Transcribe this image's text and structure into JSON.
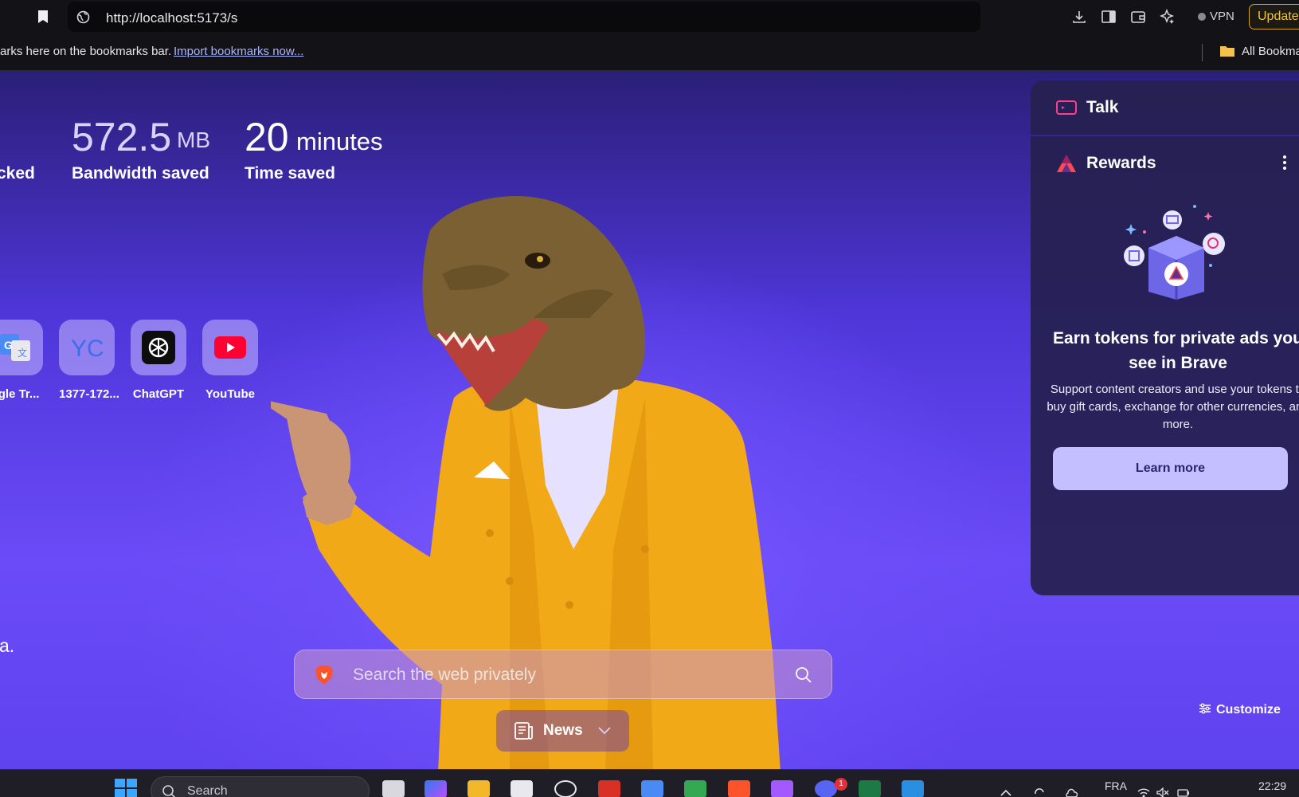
{
  "browser": {
    "url": "http://localhost:5173/s",
    "vpn_label": "VPN",
    "update_label": "Update"
  },
  "bookmarks_bar": {
    "prompt_text": "arks here on the bookmarks bar.",
    "import_link": "Import bookmarks now...",
    "all_bookmarks": "All Bookma"
  },
  "stats": {
    "blocked_label": "cked",
    "bandwidth_value": "572.5",
    "bandwidth_unit": "MB",
    "bandwidth_label": "Bandwidth saved",
    "time_value": "20",
    "time_unit": "minutes",
    "time_label": "Time saved"
  },
  "top_sites": [
    {
      "name": "ogle Tr..."
    },
    {
      "name": "1377-172..."
    },
    {
      "name": "ChatGPT"
    },
    {
      "name": "YouTube"
    }
  ],
  "page_fragment": "a.",
  "search": {
    "placeholder": "Search the web privately"
  },
  "news": {
    "label": "News"
  },
  "customize": {
    "label": "Customize"
  },
  "widgets": {
    "talk_title": "Talk",
    "rewards_title": "Rewards",
    "rewards_headline": "Earn tokens for private ads you see in Brave",
    "rewards_body": "Support content creators and use your tokens to buy gift cards, exchange for other currencies, and more.",
    "learn_more": "Learn more"
  },
  "taskbar": {
    "search_label": "Search",
    "language": "FRA",
    "time": "22:29",
    "discord_badge": "1"
  },
  "colors": {
    "accent": "#6a4bf7",
    "update_border": "#d8a51a",
    "learn_button": "#c4c0ff"
  }
}
